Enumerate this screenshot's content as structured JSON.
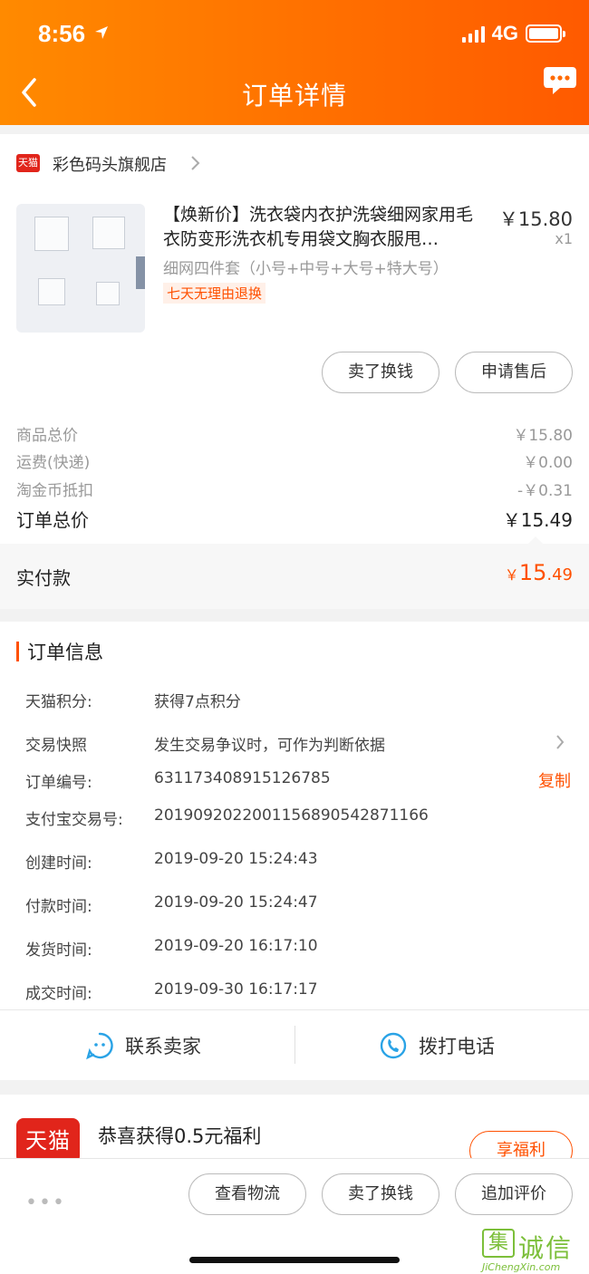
{
  "status_bar": {
    "time": "8:56",
    "network": "4G"
  },
  "header": {
    "title": "订单详情"
  },
  "shop": {
    "badge": "天猫",
    "name": "彩色码头旗舰店"
  },
  "product": {
    "title": "【焕新价】洗衣袋内衣护洗袋细网家用毛衣防变形洗衣机专用袋文胸衣服甩…",
    "price": "￥15.80",
    "qty": "x1",
    "sku": "细网四件套（小号+中号+大号+特大号）",
    "tag": "七天无理由退换"
  },
  "item_actions": {
    "sell_label": "卖了换钱",
    "after_sale_label": "申请售后"
  },
  "summary": {
    "rows": [
      {
        "label": "商品总价",
        "value": "￥15.80"
      },
      {
        "label": "运费(快递)",
        "value": "￥0.00"
      },
      {
        "label": "淘金币抵扣",
        "value": "-￥0.31"
      }
    ],
    "total_label": "订单总价",
    "total_value": "￥15.49",
    "paid_label": "实付款",
    "paid_currency": "￥",
    "paid_int": "15",
    "paid_dec": ".49"
  },
  "order_info": {
    "title": "订单信息",
    "rows": [
      {
        "label": "天猫积分:",
        "value": "获得7点积分"
      },
      {
        "label": "交易快照",
        "value": "发生交易争议时，可作为判断依据"
      },
      {
        "label": "订单编号:",
        "value": "631173408915126785"
      },
      {
        "label": "支付宝交易号:",
        "value": "2019092022001156890542871166"
      },
      {
        "label": "创建时间:",
        "value": "2019-09-20 15:24:43"
      },
      {
        "label": "付款时间:",
        "value": "2019-09-20 15:24:47"
      },
      {
        "label": "发货时间:",
        "value": "2019-09-20 16:17:10"
      },
      {
        "label": "成交时间:",
        "value": "2019-09-30 16:17:17"
      }
    ],
    "copy_label": "复制",
    "contact_seller": "联系卖家",
    "call_phone": "拨打电话"
  },
  "promo": {
    "logo": "天猫",
    "text": "恭喜获得0.5元福利",
    "button": "享福利"
  },
  "bottom_bar": {
    "more": "•••",
    "logistics": "查看物流",
    "sell": "卖了换钱",
    "review": "追加评价"
  },
  "watermark": {
    "box": "集",
    "chars": "诚信",
    "url": "JiChengXin.com"
  },
  "colors": {
    "accent": "#ff5000",
    "header_start": "#ff8a00",
    "header_end": "#ff5a00",
    "tmall_red": "#e1251b"
  }
}
